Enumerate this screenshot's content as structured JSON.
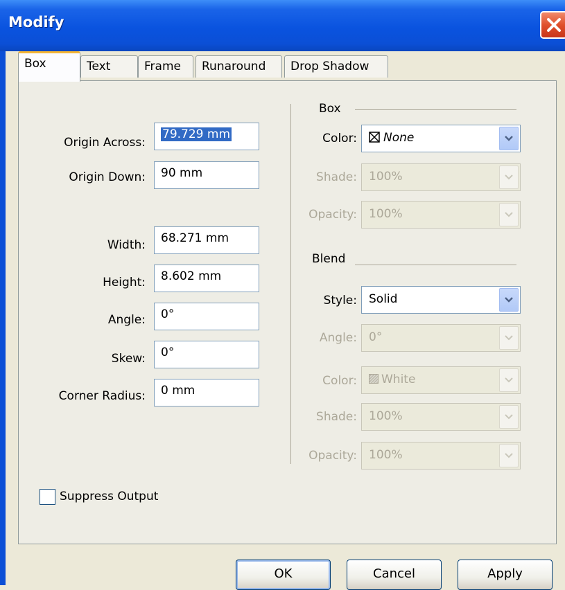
{
  "window": {
    "title": "Modify"
  },
  "tabs": [
    "Box",
    "Text",
    "Frame",
    "Runaround",
    "Drop Shadow"
  ],
  "geometry": {
    "origin_across": {
      "label": "Origin Across:",
      "value": "79.729 mm"
    },
    "origin_down": {
      "label": "Origin Down:",
      "value": "90 mm"
    },
    "width": {
      "label": "Width:",
      "value": "68.271 mm"
    },
    "height": {
      "label": "Height:",
      "value": "8.602 mm"
    },
    "angle": {
      "label": "Angle:",
      "value": "0°"
    },
    "skew": {
      "label": "Skew:",
      "value": "0°"
    },
    "corner_radius": {
      "label": "Corner Radius:",
      "value": "0 mm"
    }
  },
  "box_section": {
    "title": "Box",
    "color": {
      "label": "Color:",
      "value": "None"
    },
    "shade": {
      "label": "Shade:",
      "value": "100%"
    },
    "opacity": {
      "label": "Opacity:",
      "value": "100%"
    }
  },
  "blend_section": {
    "title": "Blend",
    "style": {
      "label": "Style:",
      "value": "Solid"
    },
    "angle": {
      "label": "Angle:",
      "value": "0°"
    },
    "color": {
      "label": "Color:",
      "value": "White"
    },
    "shade": {
      "label": "Shade:",
      "value": "100%"
    },
    "opacity": {
      "label": "Opacity:",
      "value": "100%"
    }
  },
  "suppress_output": {
    "label": "Suppress Output",
    "checked": false
  },
  "buttons": {
    "ok": "OK",
    "cancel": "Cancel",
    "apply": "Apply"
  }
}
